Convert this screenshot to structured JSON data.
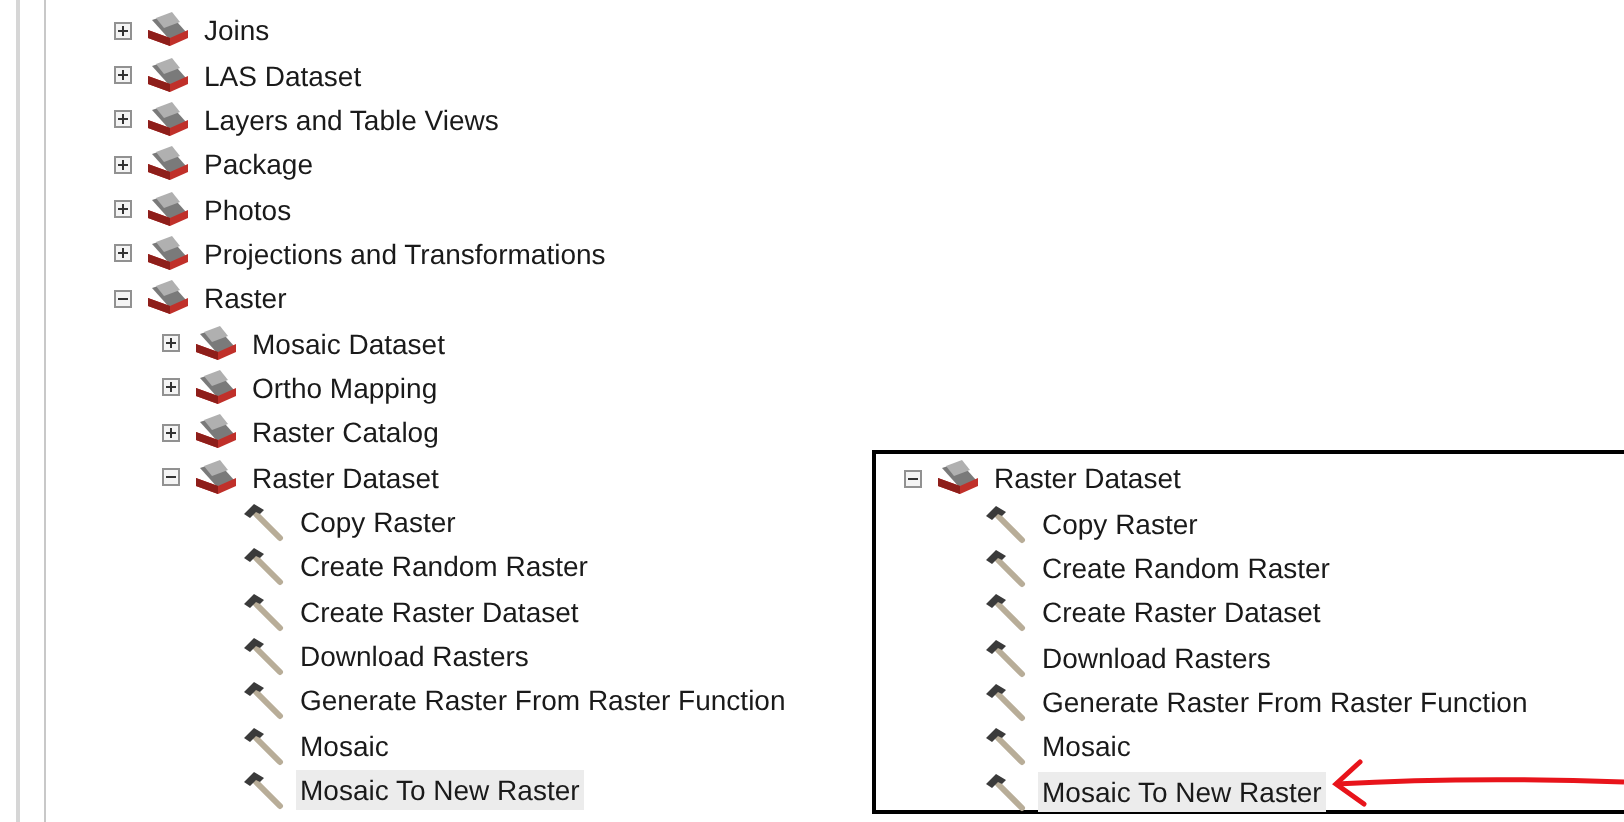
{
  "tree": [
    {
      "kind": "toolset",
      "label": "Joins",
      "expanded": false,
      "selected": false
    },
    {
      "kind": "toolset",
      "label": "LAS Dataset",
      "expanded": false,
      "selected": false
    },
    {
      "kind": "toolset",
      "label": "Layers and Table Views",
      "expanded": false,
      "selected": false
    },
    {
      "kind": "toolset",
      "label": "Package",
      "expanded": false,
      "selected": false
    },
    {
      "kind": "toolset",
      "label": "Photos",
      "expanded": false,
      "selected": false
    },
    {
      "kind": "toolset",
      "label": "Projections and Transformations",
      "expanded": false,
      "selected": false
    },
    {
      "kind": "toolset",
      "label": "Raster",
      "expanded": true,
      "selected": false,
      "children": [
        {
          "kind": "toolset",
          "label": "Mosaic Dataset",
          "expanded": false,
          "selected": false
        },
        {
          "kind": "toolset",
          "label": "Ortho Mapping",
          "expanded": false,
          "selected": false
        },
        {
          "kind": "toolset",
          "label": "Raster Catalog",
          "expanded": false,
          "selected": false
        },
        {
          "kind": "toolset",
          "label": "Raster Dataset",
          "expanded": true,
          "selected": false,
          "children": [
            {
              "kind": "tool",
              "label": "Copy Raster",
              "selected": false
            },
            {
              "kind": "tool",
              "label": "Create Random Raster",
              "selected": false
            },
            {
              "kind": "tool",
              "label": "Create Raster Dataset",
              "selected": false
            },
            {
              "kind": "tool",
              "label": "Download Rasters",
              "selected": false
            },
            {
              "kind": "tool",
              "label": "Generate Raster From Raster Function",
              "selected": false
            },
            {
              "kind": "tool",
              "label": "Mosaic",
              "selected": false
            },
            {
              "kind": "tool",
              "label": "Mosaic To New Raster",
              "selected": true
            }
          ]
        }
      ]
    }
  ],
  "inset": {
    "tree": [
      {
        "kind": "toolset",
        "label": "Raster Dataset",
        "expanded": true,
        "selected": false,
        "children": [
          {
            "kind": "tool",
            "label": "Copy Raster",
            "selected": false
          },
          {
            "kind": "tool",
            "label": "Create Random Raster",
            "selected": false
          },
          {
            "kind": "tool",
            "label": "Create Raster Dataset",
            "selected": false
          },
          {
            "kind": "tool",
            "label": "Download Rasters",
            "selected": false
          },
          {
            "kind": "tool",
            "label": "Generate Raster From Raster Function",
            "selected": false
          },
          {
            "kind": "tool",
            "label": "Mosaic",
            "selected": false
          },
          {
            "kind": "tool",
            "label": "Mosaic To New Raster",
            "selected": true
          }
        ]
      }
    ]
  }
}
